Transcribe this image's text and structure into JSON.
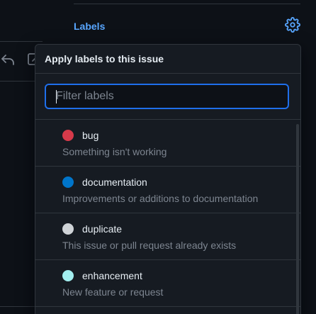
{
  "sidebar": {
    "heading": "Labels"
  },
  "dropdown": {
    "title": "Apply labels to this issue",
    "filter": {
      "placeholder": "Filter labels",
      "value": ""
    },
    "labels": [
      {
        "name": "bug",
        "description": "Something isn't working",
        "color": "#d73a4a"
      },
      {
        "name": "documentation",
        "description": "Improvements or additions to documentation",
        "color": "#0075ca"
      },
      {
        "name": "duplicate",
        "description": "This issue or pull request already exists",
        "color": "#cfd3d7"
      },
      {
        "name": "enhancement",
        "description": "New feature or request",
        "color": "#a2eeef"
      }
    ]
  },
  "icons": {
    "toolbar": [
      "reply-icon",
      "edit-icon"
    ],
    "settings": "gear-icon"
  }
}
